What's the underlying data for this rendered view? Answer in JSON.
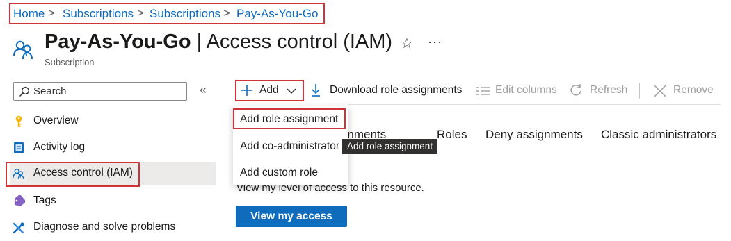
{
  "breadcrumb": {
    "items": [
      "Home",
      "Subscriptions",
      "Subscriptions",
      "Pay-As-You-Go"
    ],
    "separator": ">"
  },
  "header": {
    "title_bold": "Pay-As-You-Go",
    "title_rest": " | Access control (IAM)",
    "subtitle": "Subscription",
    "star_glyph": "☆",
    "more_glyph": "···"
  },
  "search": {
    "placeholder": "Search",
    "collapse_glyph": "«"
  },
  "sidebar": {
    "items": [
      {
        "label": "Overview",
        "icon": "key-icon"
      },
      {
        "label": "Activity log",
        "icon": "activity-log-icon"
      },
      {
        "label": "Access control (IAM)",
        "icon": "people-icon",
        "selected": true
      },
      {
        "label": "Tags",
        "icon": "tag-icon"
      },
      {
        "label": "Diagnose and solve problems",
        "icon": "wrench-icon"
      }
    ]
  },
  "toolbar": {
    "add": "Add",
    "download": "Download role assignments",
    "edit_columns": "Edit columns",
    "refresh": "Refresh",
    "remove": "Remove"
  },
  "tabs": [
    "Role assignments",
    "Roles",
    "Deny assignments",
    "Classic administrators"
  ],
  "add_menu": {
    "items": [
      "Add role assignment",
      "Add co-administrator",
      "Add custom role"
    ]
  },
  "tooltip": "Add role assignment",
  "content": {
    "description": "View my level of access to this resource.",
    "view_access_button": "View my access"
  },
  "colors": {
    "accent": "#0f6cbd",
    "highlight_border": "#d13438",
    "selected_bg": "#edebe9",
    "disabled_text": "#a19f9d"
  }
}
